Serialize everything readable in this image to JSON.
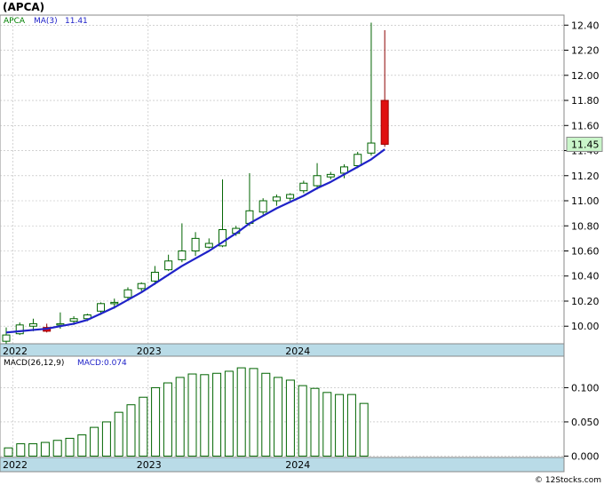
{
  "header": {
    "ticker_title": "(APCA)"
  },
  "footer": {
    "credit": "© 12Stocks.com"
  },
  "colors": {
    "panel_border": "#888888",
    "grid": "#b8b8b8",
    "axis_band": "#b9dbe7",
    "up_fill": "#ffffff",
    "up_stroke": "#006400",
    "down_fill": "#e01010",
    "ma_line": "#1f22c8",
    "macd_bar_stroke": "#006400",
    "price_tag_fill": "#c9f5c9",
    "price_label_text": "#000000",
    "macd_label_text": "#1f22c8",
    "legend_ticker_text": "#008000"
  },
  "chart_data": [
    {
      "type": "candlestick",
      "legend": {
        "ticker": "APCA",
        "ma_label": "MA(3)",
        "ma_value": "11.41"
      },
      "last_price_tag": "11.45",
      "ylim": [
        9.86,
        12.48
      ],
      "y_ticks": [
        10.0,
        10.2,
        10.4,
        10.6,
        10.8,
        11.0,
        11.2,
        11.4,
        11.6,
        11.8,
        12.0,
        12.2,
        12.4
      ],
      "y_tick_labels": [
        "10.00",
        "10.20",
        "10.40",
        "10.60",
        "10.80",
        "11.00",
        "11.20",
        "11.40",
        "11.60",
        "11.80",
        "12.00",
        "12.20",
        "12.40"
      ],
      "x_labels": [
        {
          "text": "2022",
          "index": 0.5
        },
        {
          "text": "2023",
          "index": 10.5
        },
        {
          "text": "2024",
          "index": 21.5
        }
      ],
      "candles": [
        {
          "o": 9.88,
          "h": 9.99,
          "l": 9.86,
          "c": 9.93
        },
        {
          "o": 9.94,
          "h": 10.03,
          "l": 9.93,
          "c": 10.01
        },
        {
          "o": 10.0,
          "h": 10.06,
          "l": 9.96,
          "c": 10.02
        },
        {
          "o": 9.99,
          "h": 10.02,
          "l": 9.95,
          "c": 9.96
        },
        {
          "o": 10.01,
          "h": 10.11,
          "l": 9.98,
          "c": 10.02
        },
        {
          "o": 10.04,
          "h": 10.08,
          "l": 10.01,
          "c": 10.06
        },
        {
          "o": 10.06,
          "h": 10.1,
          "l": 10.04,
          "c": 10.09
        },
        {
          "o": 10.12,
          "h": 10.19,
          "l": 10.09,
          "c": 10.18
        },
        {
          "o": 10.18,
          "h": 10.22,
          "l": 10.14,
          "c": 10.19
        },
        {
          "o": 10.23,
          "h": 10.31,
          "l": 10.21,
          "c": 10.29
        },
        {
          "o": 10.3,
          "h": 10.35,
          "l": 10.28,
          "c": 10.34
        },
        {
          "o": 10.36,
          "h": 10.48,
          "l": 10.33,
          "c": 10.43
        },
        {
          "o": 10.45,
          "h": 10.57,
          "l": 10.44,
          "c": 10.52
        },
        {
          "o": 10.53,
          "h": 10.82,
          "l": 10.51,
          "c": 10.6
        },
        {
          "o": 10.6,
          "h": 10.75,
          "l": 10.56,
          "c": 10.7
        },
        {
          "o": 10.63,
          "h": 10.7,
          "l": 10.62,
          "c": 10.66
        },
        {
          "o": 10.64,
          "h": 11.17,
          "l": 10.63,
          "c": 10.77
        },
        {
          "o": 10.74,
          "h": 10.8,
          "l": 10.72,
          "c": 10.78
        },
        {
          "o": 10.82,
          "h": 11.22,
          "l": 10.8,
          "c": 10.92
        },
        {
          "o": 10.91,
          "h": 11.02,
          "l": 10.89,
          "c": 11.0
        },
        {
          "o": 11.0,
          "h": 11.05,
          "l": 10.96,
          "c": 11.03
        },
        {
          "o": 11.02,
          "h": 11.06,
          "l": 11.0,
          "c": 11.05
        },
        {
          "o": 11.08,
          "h": 11.16,
          "l": 11.06,
          "c": 11.14
        },
        {
          "o": 11.12,
          "h": 11.3,
          "l": 11.09,
          "c": 11.2
        },
        {
          "o": 11.19,
          "h": 11.23,
          "l": 11.17,
          "c": 11.21
        },
        {
          "o": 11.22,
          "h": 11.29,
          "l": 11.18,
          "c": 11.27
        },
        {
          "o": 11.28,
          "h": 11.39,
          "l": 11.26,
          "c": 11.37
        },
        {
          "o": 11.38,
          "h": 12.42,
          "l": 11.36,
          "c": 11.46
        },
        {
          "o": 11.8,
          "h": 12.36,
          "l": 11.43,
          "c": 11.45
        }
      ],
      "ma3": [
        9.95,
        9.96,
        9.97,
        9.98,
        10.0,
        10.02,
        10.05,
        10.1,
        10.15,
        10.21,
        10.27,
        10.34,
        10.41,
        10.48,
        10.54,
        10.6,
        10.67,
        10.74,
        10.82,
        10.88,
        10.94,
        10.99,
        11.04,
        11.1,
        11.15,
        11.21,
        11.27,
        11.33,
        11.41
      ]
    },
    {
      "type": "bar",
      "legend": {
        "name": "MACD(26,12,9)",
        "value_label": "MACD:0.074"
      },
      "ylim": [
        -0.002,
        0.146
      ],
      "y_ticks": [
        0.0,
        0.05,
        0.1
      ],
      "y_tick_labels": [
        "0.000",
        "0.050",
        "0.100"
      ],
      "x_labels": [
        {
          "text": "2022",
          "index": 0.5
        },
        {
          "text": "2023",
          "index": 10.5
        },
        {
          "text": "2024",
          "index": 21.5
        }
      ],
      "values": [
        0.012,
        0.018,
        0.018,
        0.02,
        0.023,
        0.026,
        0.031,
        0.042,
        0.05,
        0.064,
        0.075,
        0.086,
        0.1,
        0.107,
        0.115,
        0.12,
        0.119,
        0.121,
        0.124,
        0.129,
        0.128,
        0.121,
        0.115,
        0.111,
        0.103,
        0.099,
        0.093,
        0.09,
        0.09,
        0.077
      ]
    }
  ]
}
